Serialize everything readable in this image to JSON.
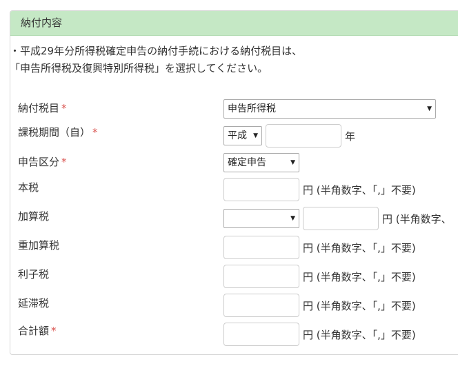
{
  "header": {
    "title": "納付内容"
  },
  "notice": {
    "line1": "・平成29年分所得税確定申告の納付手続における納付税目は、",
    "line2": "「申告所得税及復興特別所得税」を選択してください。"
  },
  "required_mark": "*",
  "fields": {
    "tax_item": {
      "label": "納付税目",
      "value": "申告所得税"
    },
    "tax_period": {
      "label": "課税期間（自）",
      "era_value": "平成",
      "year_value": "",
      "year_unit": "年"
    },
    "filing_type": {
      "label": "申告区分",
      "value": "確定申告"
    },
    "main_tax": {
      "label": "本税",
      "value": "",
      "unit": "円 (半角数字、「,」不要)"
    },
    "additional_tax": {
      "label": "加算税",
      "select_value": "",
      "value": "",
      "unit": "円 (半角数字、"
    },
    "heavy_additional_tax": {
      "label": "重加算税",
      "value": "",
      "unit": "円 (半角数字、「,」不要)"
    },
    "interest_tax": {
      "label": "利子税",
      "value": "",
      "unit": "円 (半角数字、「,」不要)"
    },
    "delinquency_tax": {
      "label": "延滞税",
      "value": "",
      "unit": "円 (半角数字、「,」不要)"
    },
    "total": {
      "label": "合計額",
      "value": "",
      "unit": "円 (半角数字、「,」不要)"
    }
  },
  "icons": {
    "dropdown": "caret-down-icon"
  }
}
